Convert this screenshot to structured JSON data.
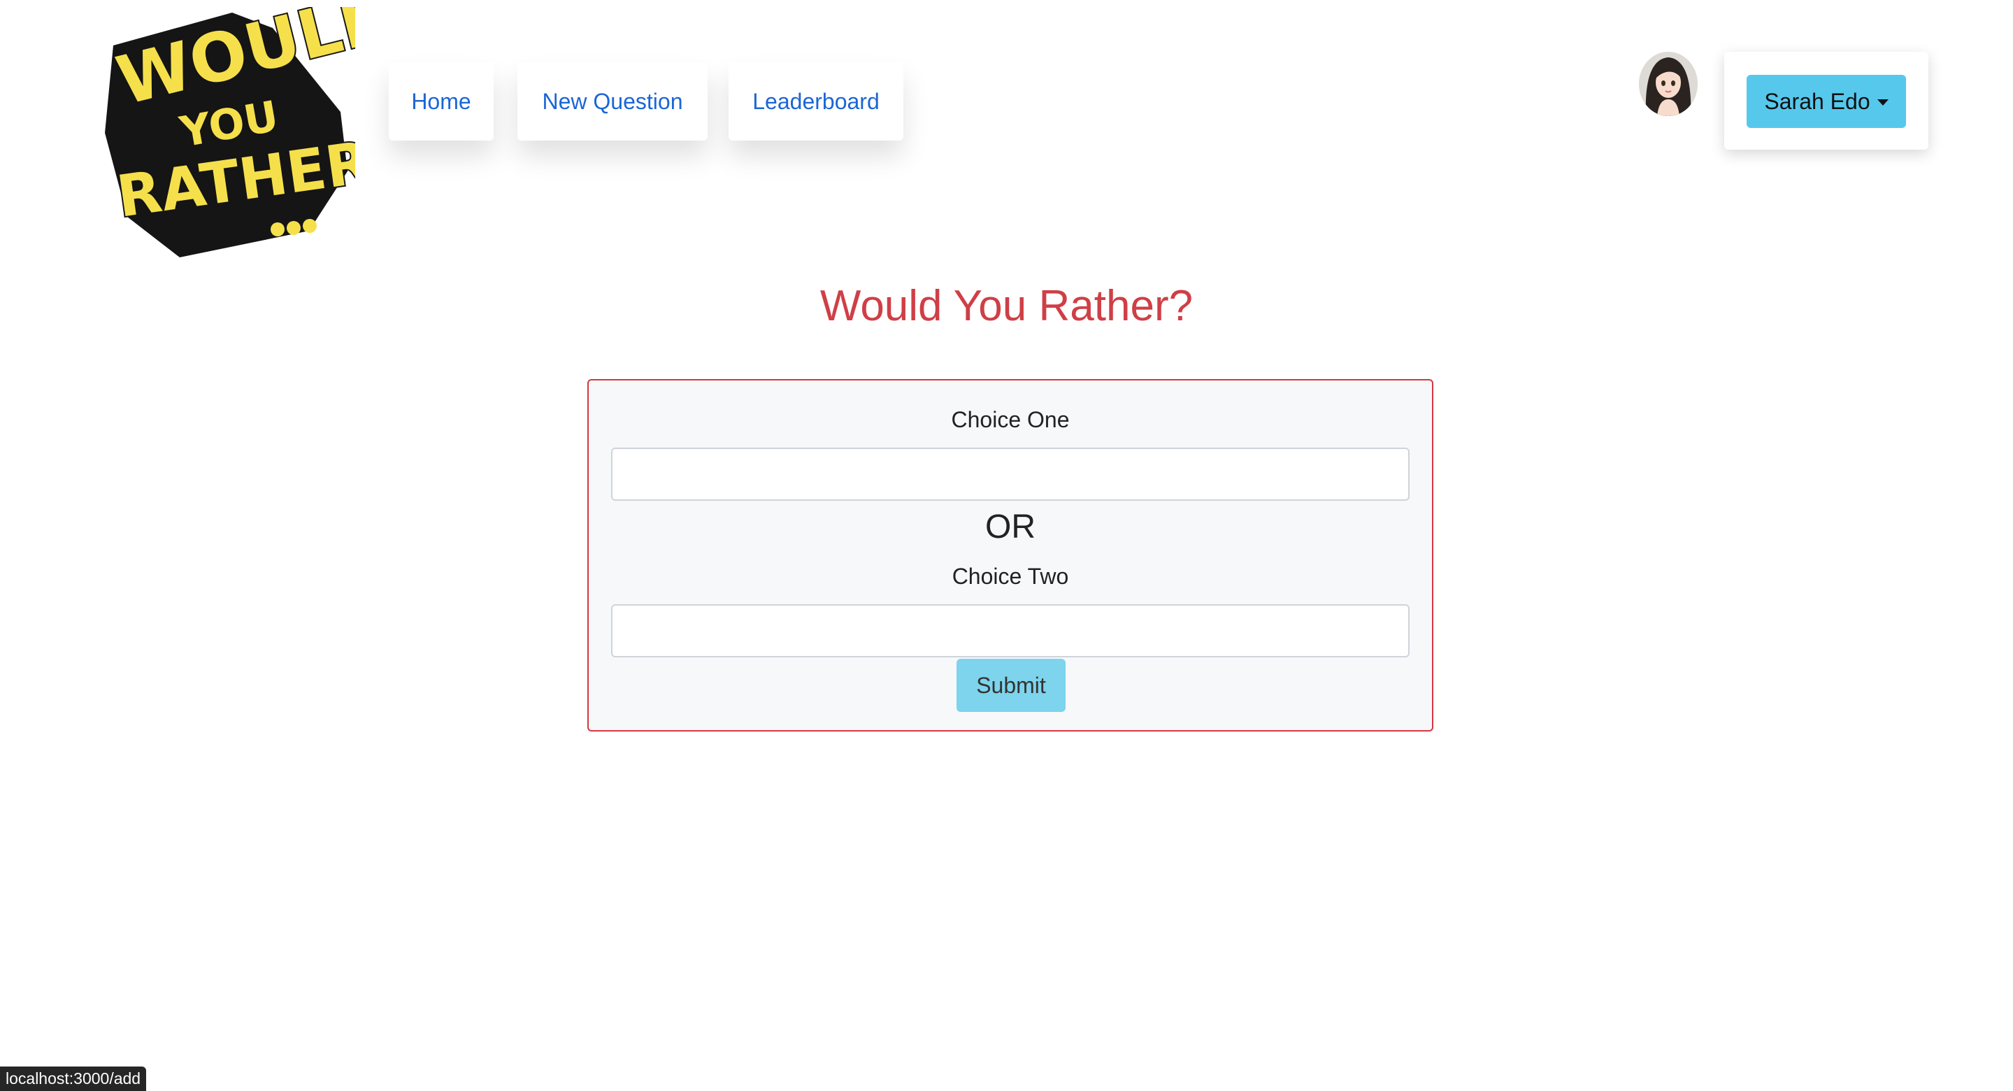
{
  "header": {
    "logo": {
      "line1": "WOULD",
      "line2": "YOU",
      "line3": "RATHER?",
      "icon": "would-you-rather-logo"
    },
    "nav": {
      "home": "Home",
      "new_question": "New Question",
      "leaderboard": "Leaderboard"
    },
    "user": {
      "name": "Sarah Edo",
      "avatar_icon": "user-avatar"
    }
  },
  "main": {
    "title": "Would You Rather?",
    "form": {
      "choice_one_label": "Choice One",
      "choice_one_value": "",
      "or_text": "OR",
      "choice_two_label": "Choice Two",
      "choice_two_value": "",
      "submit_label": "Submit"
    }
  },
  "status_bar": {
    "url": "localhost:3000/add"
  },
  "colors": {
    "accent_red": "#cf3f46",
    "link_blue": "#1a66d6",
    "button_cyan": "#56c8ec",
    "logo_yellow": "#f5e04b"
  }
}
